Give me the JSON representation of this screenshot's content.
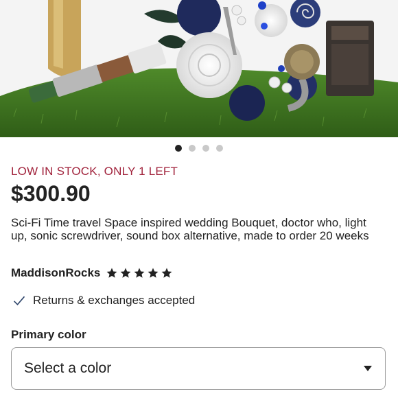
{
  "gallery": {
    "image_description_icon": "bouquet-image",
    "dots": [
      true,
      false,
      false,
      false
    ]
  },
  "listing": {
    "stock_text": "LOW IN STOCK, ONLY 1 LEFT",
    "price": "$300.90",
    "title": "Sci-Fi Time travel Space inspired wedding Bouquet, doctor who, light up, sonic screwdriver, sound box alternative, made to order 20 weeks",
    "shop_name": "MaddisonRocks",
    "rating": 5,
    "rating_max": 5,
    "returns_text": "Returns & exchanges accepted"
  },
  "options": {
    "primary_color_label": "Primary color",
    "primary_color_placeholder": "Select a color"
  },
  "colors": {
    "stock": "#a1233c",
    "text": "#222222",
    "check": "#2f466c"
  }
}
